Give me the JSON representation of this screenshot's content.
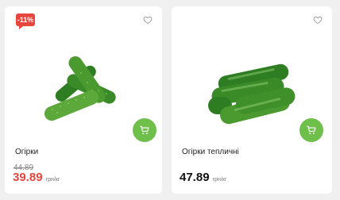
{
  "colors": {
    "discount_badge": "#e8463d",
    "sale_price": "#e8463d",
    "cart_button": "#6fbf4b",
    "cucumber_dark": "#2f7d22",
    "cucumber_light": "#5da83a"
  },
  "products": [
    {
      "badge": "-11%",
      "name": "Огірки",
      "old_price": "44.89",
      "price": "39.89",
      "unit": "грн/кг",
      "icons": {
        "favorite": "heart-outline-icon",
        "cart": "cart-icon"
      }
    },
    {
      "name": "Огірки тепличні",
      "price": "47.89",
      "unit": "грн/кг",
      "icons": {
        "favorite": "heart-outline-icon",
        "cart": "cart-icon"
      }
    }
  ]
}
